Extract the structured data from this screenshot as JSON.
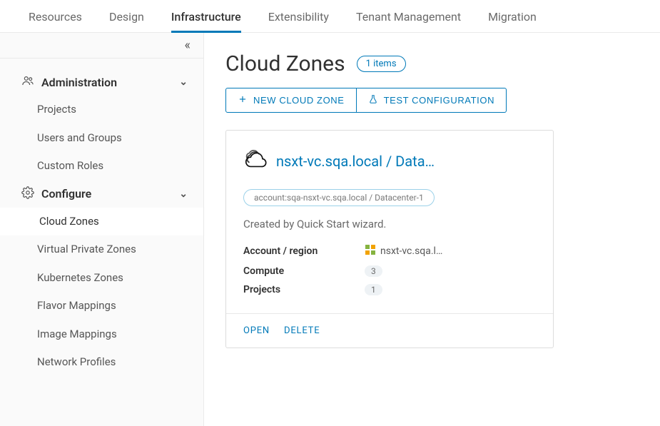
{
  "tabs": [
    "Resources",
    "Design",
    "Infrastructure",
    "Extensibility",
    "Tenant Management",
    "Migration"
  ],
  "active_tab": "Infrastructure",
  "sidebar": {
    "sections": [
      {
        "icon": "users",
        "label": "Administration",
        "items": [
          "Projects",
          "Users and Groups",
          "Custom Roles"
        ]
      },
      {
        "icon": "gear",
        "label": "Configure",
        "items": [
          "Cloud Zones",
          "Virtual Private Zones",
          "Kubernetes Zones",
          "Flavor Mappings",
          "Image Mappings",
          "Network Profiles"
        ]
      }
    ],
    "active_item": "Cloud Zones"
  },
  "page": {
    "title": "Cloud Zones",
    "items_badge": "1 items",
    "new_button": "New Cloud Zone",
    "test_button": "Test Configuration"
  },
  "card": {
    "title": "nsxt-vc.sqa.local / Data…",
    "tag": "account:sqa-nsxt-vc.sqa.local / Datacenter-1",
    "description": "Created by Quick Start wizard.",
    "rows": {
      "account_label": "Account / region",
      "account_value": "nsxt-vc.sqa.l…",
      "compute_label": "Compute",
      "compute_value": "3",
      "projects_label": "Projects",
      "projects_value": "1"
    },
    "open": "Open",
    "delete": "Delete"
  }
}
